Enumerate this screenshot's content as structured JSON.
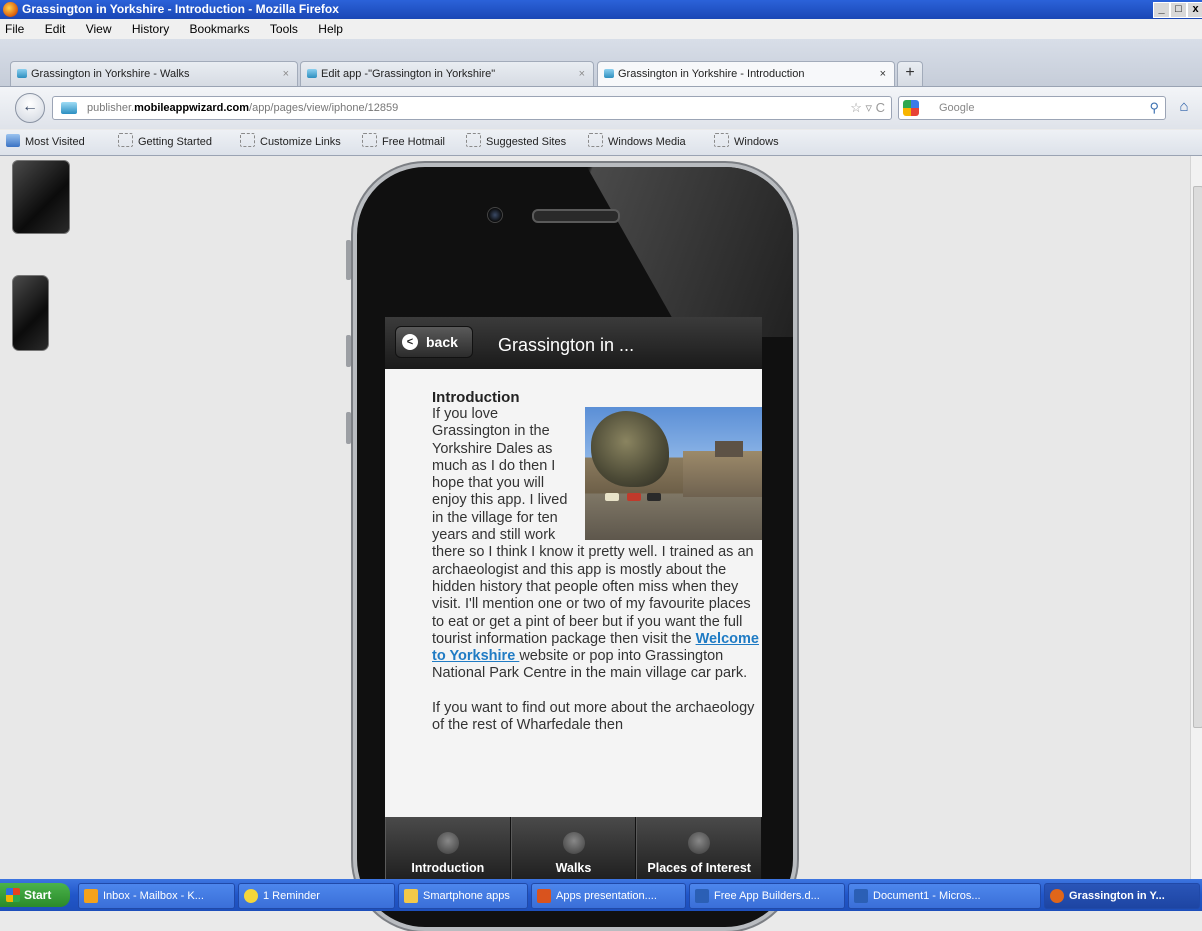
{
  "window": {
    "title": "Grassington in Yorkshire - Introduction - Mozilla Firefox",
    "controls": [
      "_",
      "□",
      "x"
    ]
  },
  "menu": [
    "File",
    "Edit",
    "View",
    "History",
    "Bookmarks",
    "Tools",
    "Help"
  ],
  "tabs": [
    {
      "label": "Grassington in Yorkshire - Walks",
      "close": "×"
    },
    {
      "label": "Edit app -\"Grassington in Yorkshire\"",
      "close": "×"
    },
    {
      "label": "Grassington in Yorkshire - Introduction",
      "close": "×"
    }
  ],
  "new_tab": "+",
  "nav": {
    "back_icon": "←",
    "url_prefix": "publisher.",
    "url_domain": "mobileappwizard.com",
    "url_path": "/app/pages/view/iphone/12859",
    "url_controls": "☆ ▿ C",
    "search_placeholder": "Google",
    "search_icon": "⚲",
    "home_icon": "⌂"
  },
  "bookmarks": [
    "Most Visited",
    "Getting Started",
    "Customize Links",
    "Free Hotmail",
    "Suggested Sites",
    "Windows Media",
    "Windows"
  ],
  "app": {
    "back_label": "back",
    "back_icon": "<",
    "title": "Grassington in ...",
    "heading": "Introduction",
    "para1_before": "If you love Grassington in the Yorkshire Dales as much as I do then I hope that you will enjoy this app. I lived in the village for ten years and still work there so I think I know it pretty well. I trained as an archaeologist and this app is mostly about the hidden history that people often miss when they visit. I'll mention one or two of my favourite places to eat or get a pint of beer but if you want the full tourist information package then visit the ",
    "para1_link": "Welcome to Yorkshire ",
    "para1_after": "website or pop into Grassington National Park Centre in the main village car park.",
    "para2": "If you want to find out more about the archaeology of the rest of Wharfedale then",
    "tabs": [
      "Introduction",
      "Walks",
      "Places of Interest"
    ]
  },
  "taskbar": {
    "start": "Start",
    "items": [
      {
        "label": "Inbox - Mailbox - K...",
        "color": "#f4a21c"
      },
      {
        "label": "1 Reminder",
        "color": "#f5d63a"
      },
      {
        "label": "Smartphone apps",
        "color": "#f3c94a"
      },
      {
        "label": "Apps presentation....",
        "color": "#d9531e"
      },
      {
        "label": "Free App Builders.d...",
        "color": "#2b5fb5"
      },
      {
        "label": "Document1 - Micros...",
        "color": "#2b5fb5"
      },
      {
        "label": "Grassington in Y...",
        "color": "#e0661a"
      }
    ]
  }
}
